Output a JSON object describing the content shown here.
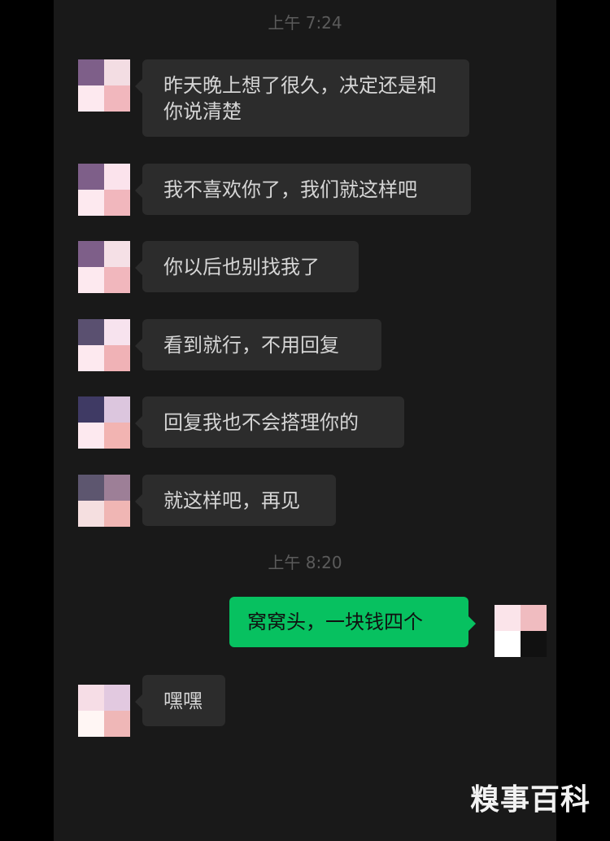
{
  "chat": {
    "time_1": "上午 7:24",
    "time_2": "上午 8:20",
    "messages": [
      {
        "sender": "other",
        "text": "昨天晚上想了很久，决定还是和你说清楚"
      },
      {
        "sender": "other",
        "text": "我不喜欢你了，我们就这样吧"
      },
      {
        "sender": "other",
        "text": "你以后也别找我了"
      },
      {
        "sender": "other",
        "text": "看到就行，不用回复"
      },
      {
        "sender": "other",
        "text": "回复我也不会搭理你的"
      },
      {
        "sender": "other",
        "text": "就这样吧，再见"
      },
      {
        "sender": "me",
        "text": "窝窝头，一块钱四个"
      },
      {
        "sender": "other",
        "text": "嘿嘿"
      }
    ]
  },
  "watermark": "糗事百科",
  "colors": {
    "background": "#191919",
    "incoming_bubble": "#2c2c2c",
    "outgoing_bubble": "#07c160",
    "timestamp": "#5b5b5b"
  }
}
